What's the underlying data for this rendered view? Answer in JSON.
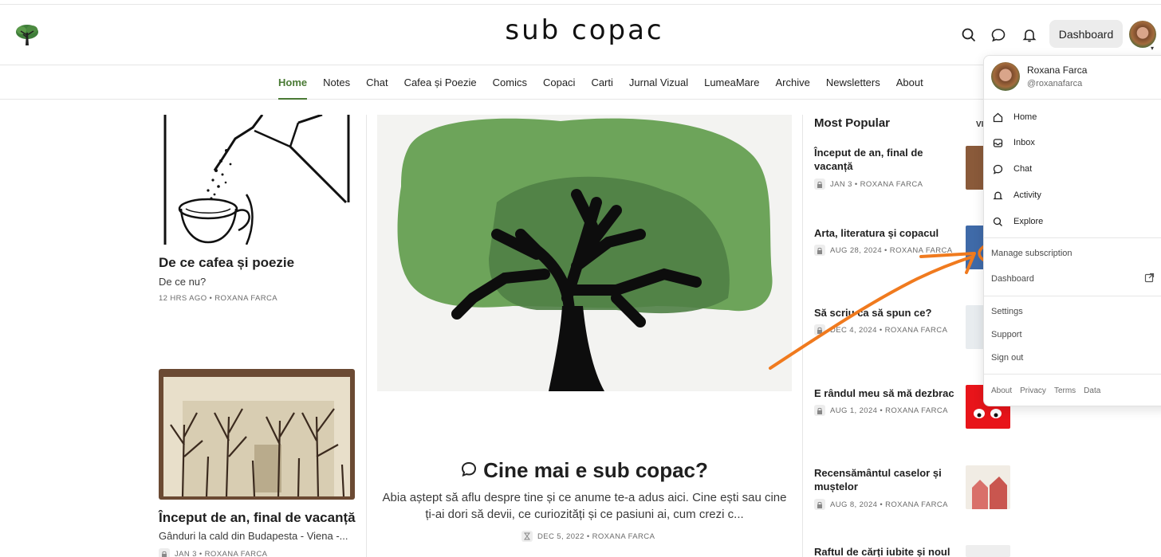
{
  "header": {
    "site_title": "sub copac",
    "dashboard_label": "Dashboard",
    "icons": [
      "search-icon",
      "chat-bubble-icon",
      "bell-icon"
    ]
  },
  "nav": {
    "items": [
      {
        "label": "Home",
        "active": true
      },
      {
        "label": "Notes"
      },
      {
        "label": "Chat"
      },
      {
        "label": "Cafea și Poezie"
      },
      {
        "label": "Comics"
      },
      {
        "label": "Copaci"
      },
      {
        "label": "Carti"
      },
      {
        "label": "Jurnal Vizual"
      },
      {
        "label": "LumeaMare"
      },
      {
        "label": "Archive"
      },
      {
        "label": "Newsletters"
      },
      {
        "label": "About"
      }
    ],
    "accent_color": "#4a7a34"
  },
  "left_posts": [
    {
      "title": "De ce cafea și poezie",
      "subtitle": "De ce nu?",
      "meta": "12 HRS AGO • ROXANA FARCA"
    },
    {
      "title": "Început de an, final de vacanță",
      "subtitle": "Gânduri la cald din Budapesta - Viena -...",
      "meta": "JAN 3 • ROXANA FARCA"
    }
  ],
  "featured": {
    "title": "Cine mai e sub copac?",
    "excerpt": "Abia aștept să aflu despre tine și ce anume te-a adus aici. Cine ești sau cine ți-ai dori să devii, ce curiozități și ce pasiuni ai, cum crezi c...",
    "meta": "DEC 5, 2022 • ROXANA FARCA"
  },
  "popular": {
    "heading": "Most Popular",
    "view_all": "VI",
    "items": [
      {
        "title": "Început de an, final de vacanță",
        "meta": "JAN 3 • ROXANA FARCA"
      },
      {
        "title": "Arta, literatura și copacul",
        "meta": "AUG 28, 2024 • ROXANA FARCA"
      },
      {
        "title": "Să scriu ca să spun ce?",
        "meta": "DEC 4, 2024 • ROXANA FARCA"
      },
      {
        "title": "E rândul meu să mă dezbrac",
        "meta": "AUG 1, 2024 • ROXANA FARCA"
      },
      {
        "title": "Recensământul caselor și muștelor",
        "meta": "AUG 8, 2024 • ROXANA FARCA"
      },
      {
        "title": "Raftul de cărți iubite și noul",
        "meta": ""
      }
    ]
  },
  "menu": {
    "user_name": "Roxana Farca",
    "user_handle": "@roxanafarca",
    "items": [
      {
        "label": "Home",
        "icon": "home-icon"
      },
      {
        "label": "Inbox",
        "icon": "inbox-icon"
      },
      {
        "label": "Chat",
        "icon": "chat-bubble-icon"
      },
      {
        "label": "Activity",
        "icon": "bell-icon"
      },
      {
        "label": "Explore",
        "icon": "search-icon"
      }
    ],
    "manage_subscription": "Manage subscription",
    "dashboard": "Dashboard",
    "settings": "Settings",
    "support": "Support",
    "sign_out": "Sign out",
    "footer": [
      "About",
      "Privacy",
      "Terms",
      "Data"
    ]
  },
  "annotation_color": "#f07a1e"
}
